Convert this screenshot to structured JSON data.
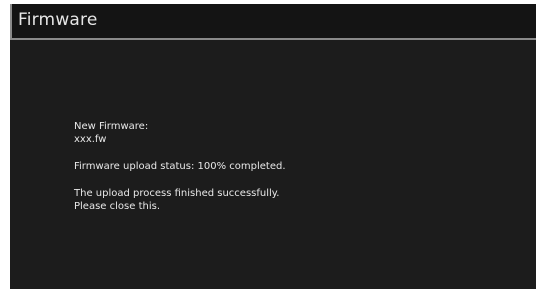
{
  "window": {
    "title": "Firmware"
  },
  "firmware": {
    "new_label": "New Firmware:",
    "filename": "xxx.fw",
    "upload_status": "Firmware upload status: 100% completed.",
    "result_line1": "The upload process finished successfully.",
    "result_line2": "Please close this."
  },
  "colors": {
    "background": "#1c1c1c",
    "title_bar": "#141414",
    "border": "#8a8a8a",
    "text": "#e8e8e8"
  }
}
